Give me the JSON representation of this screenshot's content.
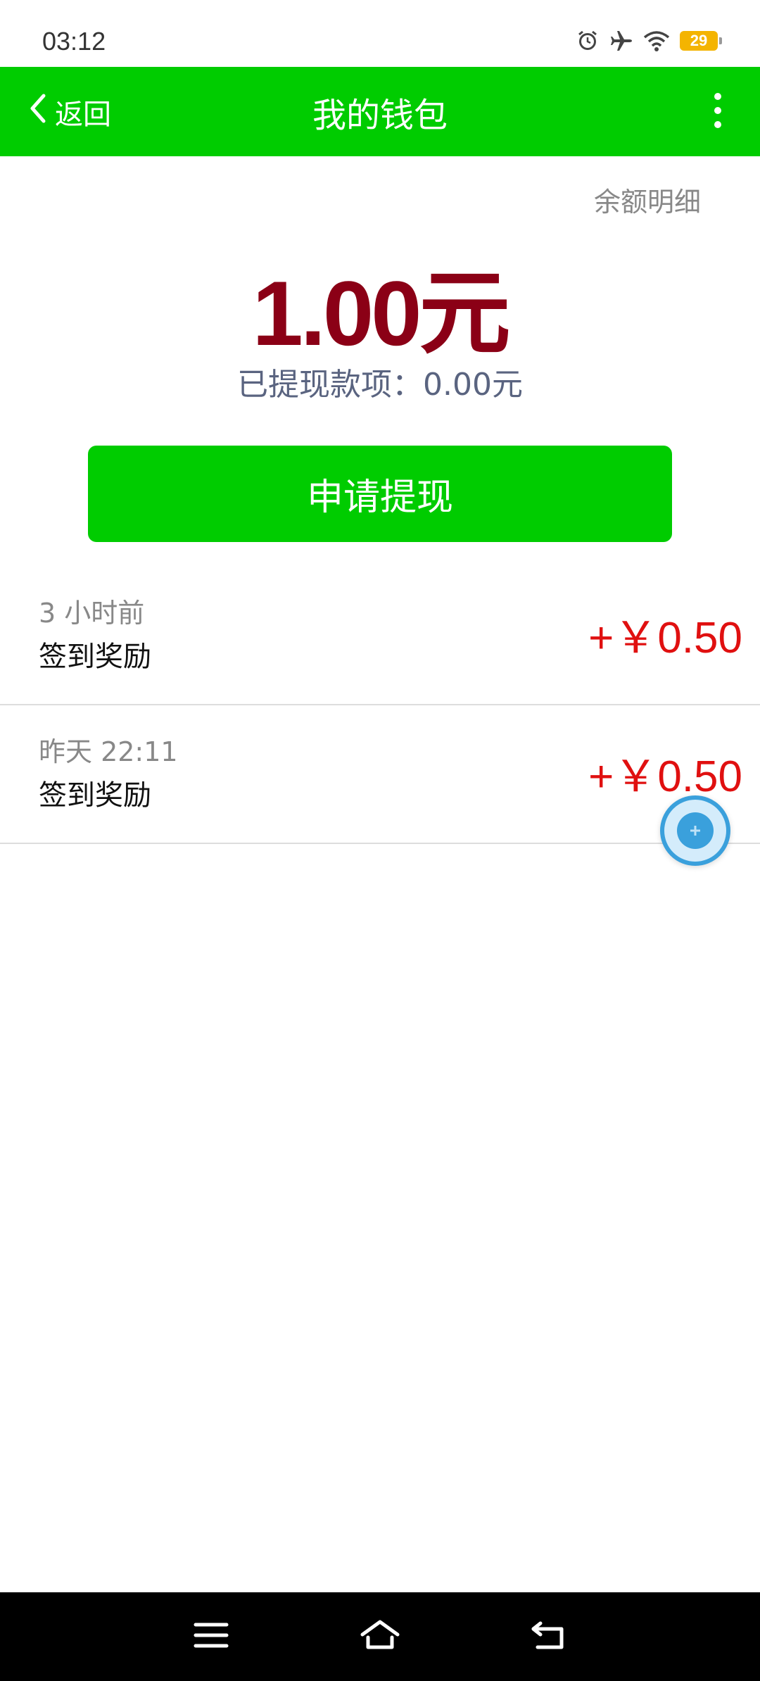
{
  "status_bar": {
    "time": "03:12",
    "battery_level": "29",
    "icons": [
      "alarm-icon",
      "airplane-icon",
      "wifi-icon",
      "battery-icon"
    ]
  },
  "app_bar": {
    "back_label": "返回",
    "title": "我的钱包",
    "background_color": "#00cc00"
  },
  "wallet": {
    "balance_detail_link": "余额明细",
    "balance": "1.00元",
    "withdrawn_text": "已提现款项：0.00元",
    "withdraw_button_label": "申请提现",
    "balance_color": "#8b0016"
  },
  "transactions": [
    {
      "time": "3 小时前",
      "description": "签到奖励",
      "amount": "+￥0.50"
    },
    {
      "time": "昨天 22:11",
      "description": "签到奖励",
      "amount": "+￥0.50"
    }
  ],
  "amount_color": "#e01010",
  "navigation_bar": {
    "icons": [
      "menu-icon",
      "home-icon",
      "back-icon"
    ]
  }
}
